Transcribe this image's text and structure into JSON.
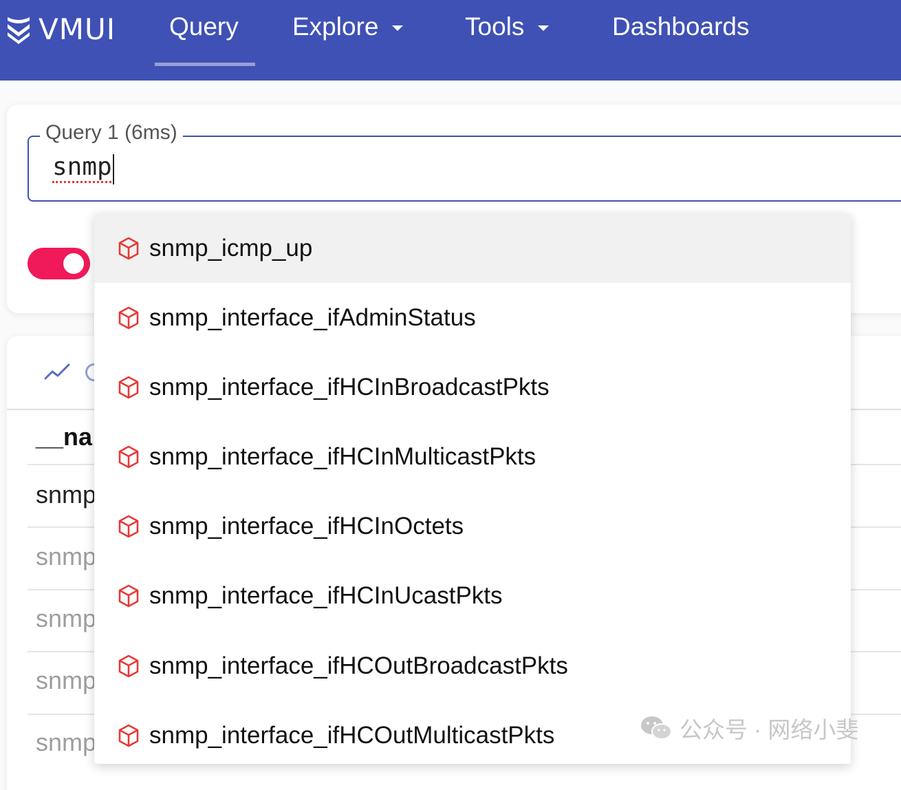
{
  "app": {
    "logo_text": "VMUI",
    "colors": {
      "header": "#3f51b5",
      "accent": "#f0195a",
      "icon": "#e53935"
    }
  },
  "nav": {
    "items": [
      {
        "label": "Query",
        "active": true
      },
      {
        "label": "Explore",
        "dropdown": true
      },
      {
        "label": "Tools",
        "dropdown": true
      },
      {
        "label": "Dashboards"
      }
    ]
  },
  "query": {
    "label": "Query 1 (6ms)",
    "value": "snmp"
  },
  "results": {
    "column_header": "__na",
    "rows": [
      "snmp",
      "snmp",
      "snmp",
      "snmp",
      "snmp"
    ]
  },
  "autocomplete": {
    "icon": "metric-cube-icon",
    "items": [
      "snmp_icmp_up",
      "snmp_interface_ifAdminStatus",
      "snmp_interface_ifHCInBroadcastPkts",
      "snmp_interface_ifHCInMulticastPkts",
      "snmp_interface_ifHCInOctets",
      "snmp_interface_ifHCInUcastPkts",
      "snmp_interface_ifHCOutBroadcastPkts",
      "snmp_interface_ifHCOutMulticastPkts"
    ]
  },
  "watermark": {
    "text": "公众号 · 网络小斐"
  }
}
